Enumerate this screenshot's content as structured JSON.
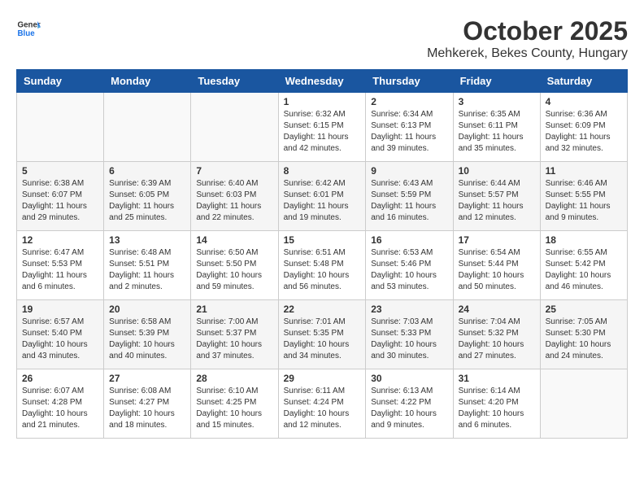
{
  "header": {
    "logo": {
      "general": "General",
      "blue": "Blue"
    },
    "title": "October 2025",
    "location": "Mehkerek, Bekes County, Hungary"
  },
  "weekdays": [
    "Sunday",
    "Monday",
    "Tuesday",
    "Wednesday",
    "Thursday",
    "Friday",
    "Saturday"
  ],
  "weeks": [
    [
      {
        "day": "",
        "info": ""
      },
      {
        "day": "",
        "info": ""
      },
      {
        "day": "",
        "info": ""
      },
      {
        "day": "1",
        "info": "Sunrise: 6:32 AM\nSunset: 6:15 PM\nDaylight: 11 hours\nand 42 minutes."
      },
      {
        "day": "2",
        "info": "Sunrise: 6:34 AM\nSunset: 6:13 PM\nDaylight: 11 hours\nand 39 minutes."
      },
      {
        "day": "3",
        "info": "Sunrise: 6:35 AM\nSunset: 6:11 PM\nDaylight: 11 hours\nand 35 minutes."
      },
      {
        "day": "4",
        "info": "Sunrise: 6:36 AM\nSunset: 6:09 PM\nDaylight: 11 hours\nand 32 minutes."
      }
    ],
    [
      {
        "day": "5",
        "info": "Sunrise: 6:38 AM\nSunset: 6:07 PM\nDaylight: 11 hours\nand 29 minutes."
      },
      {
        "day": "6",
        "info": "Sunrise: 6:39 AM\nSunset: 6:05 PM\nDaylight: 11 hours\nand 25 minutes."
      },
      {
        "day": "7",
        "info": "Sunrise: 6:40 AM\nSunset: 6:03 PM\nDaylight: 11 hours\nand 22 minutes."
      },
      {
        "day": "8",
        "info": "Sunrise: 6:42 AM\nSunset: 6:01 PM\nDaylight: 11 hours\nand 19 minutes."
      },
      {
        "day": "9",
        "info": "Sunrise: 6:43 AM\nSunset: 5:59 PM\nDaylight: 11 hours\nand 16 minutes."
      },
      {
        "day": "10",
        "info": "Sunrise: 6:44 AM\nSunset: 5:57 PM\nDaylight: 11 hours\nand 12 minutes."
      },
      {
        "day": "11",
        "info": "Sunrise: 6:46 AM\nSunset: 5:55 PM\nDaylight: 11 hours\nand 9 minutes."
      }
    ],
    [
      {
        "day": "12",
        "info": "Sunrise: 6:47 AM\nSunset: 5:53 PM\nDaylight: 11 hours\nand 6 minutes."
      },
      {
        "day": "13",
        "info": "Sunrise: 6:48 AM\nSunset: 5:51 PM\nDaylight: 11 hours\nand 2 minutes."
      },
      {
        "day": "14",
        "info": "Sunrise: 6:50 AM\nSunset: 5:50 PM\nDaylight: 10 hours\nand 59 minutes."
      },
      {
        "day": "15",
        "info": "Sunrise: 6:51 AM\nSunset: 5:48 PM\nDaylight: 10 hours\nand 56 minutes."
      },
      {
        "day": "16",
        "info": "Sunrise: 6:53 AM\nSunset: 5:46 PM\nDaylight: 10 hours\nand 53 minutes."
      },
      {
        "day": "17",
        "info": "Sunrise: 6:54 AM\nSunset: 5:44 PM\nDaylight: 10 hours\nand 50 minutes."
      },
      {
        "day": "18",
        "info": "Sunrise: 6:55 AM\nSunset: 5:42 PM\nDaylight: 10 hours\nand 46 minutes."
      }
    ],
    [
      {
        "day": "19",
        "info": "Sunrise: 6:57 AM\nSunset: 5:40 PM\nDaylight: 10 hours\nand 43 minutes."
      },
      {
        "day": "20",
        "info": "Sunrise: 6:58 AM\nSunset: 5:39 PM\nDaylight: 10 hours\nand 40 minutes."
      },
      {
        "day": "21",
        "info": "Sunrise: 7:00 AM\nSunset: 5:37 PM\nDaylight: 10 hours\nand 37 minutes."
      },
      {
        "day": "22",
        "info": "Sunrise: 7:01 AM\nSunset: 5:35 PM\nDaylight: 10 hours\nand 34 minutes."
      },
      {
        "day": "23",
        "info": "Sunrise: 7:03 AM\nSunset: 5:33 PM\nDaylight: 10 hours\nand 30 minutes."
      },
      {
        "day": "24",
        "info": "Sunrise: 7:04 AM\nSunset: 5:32 PM\nDaylight: 10 hours\nand 27 minutes."
      },
      {
        "day": "25",
        "info": "Sunrise: 7:05 AM\nSunset: 5:30 PM\nDaylight: 10 hours\nand 24 minutes."
      }
    ],
    [
      {
        "day": "26",
        "info": "Sunrise: 6:07 AM\nSunset: 4:28 PM\nDaylight: 10 hours\nand 21 minutes."
      },
      {
        "day": "27",
        "info": "Sunrise: 6:08 AM\nSunset: 4:27 PM\nDaylight: 10 hours\nand 18 minutes."
      },
      {
        "day": "28",
        "info": "Sunrise: 6:10 AM\nSunset: 4:25 PM\nDaylight: 10 hours\nand 15 minutes."
      },
      {
        "day": "29",
        "info": "Sunrise: 6:11 AM\nSunset: 4:24 PM\nDaylight: 10 hours\nand 12 minutes."
      },
      {
        "day": "30",
        "info": "Sunrise: 6:13 AM\nSunset: 4:22 PM\nDaylight: 10 hours\nand 9 minutes."
      },
      {
        "day": "31",
        "info": "Sunrise: 6:14 AM\nSunset: 4:20 PM\nDaylight: 10 hours\nand 6 minutes."
      },
      {
        "day": "",
        "info": ""
      }
    ]
  ]
}
